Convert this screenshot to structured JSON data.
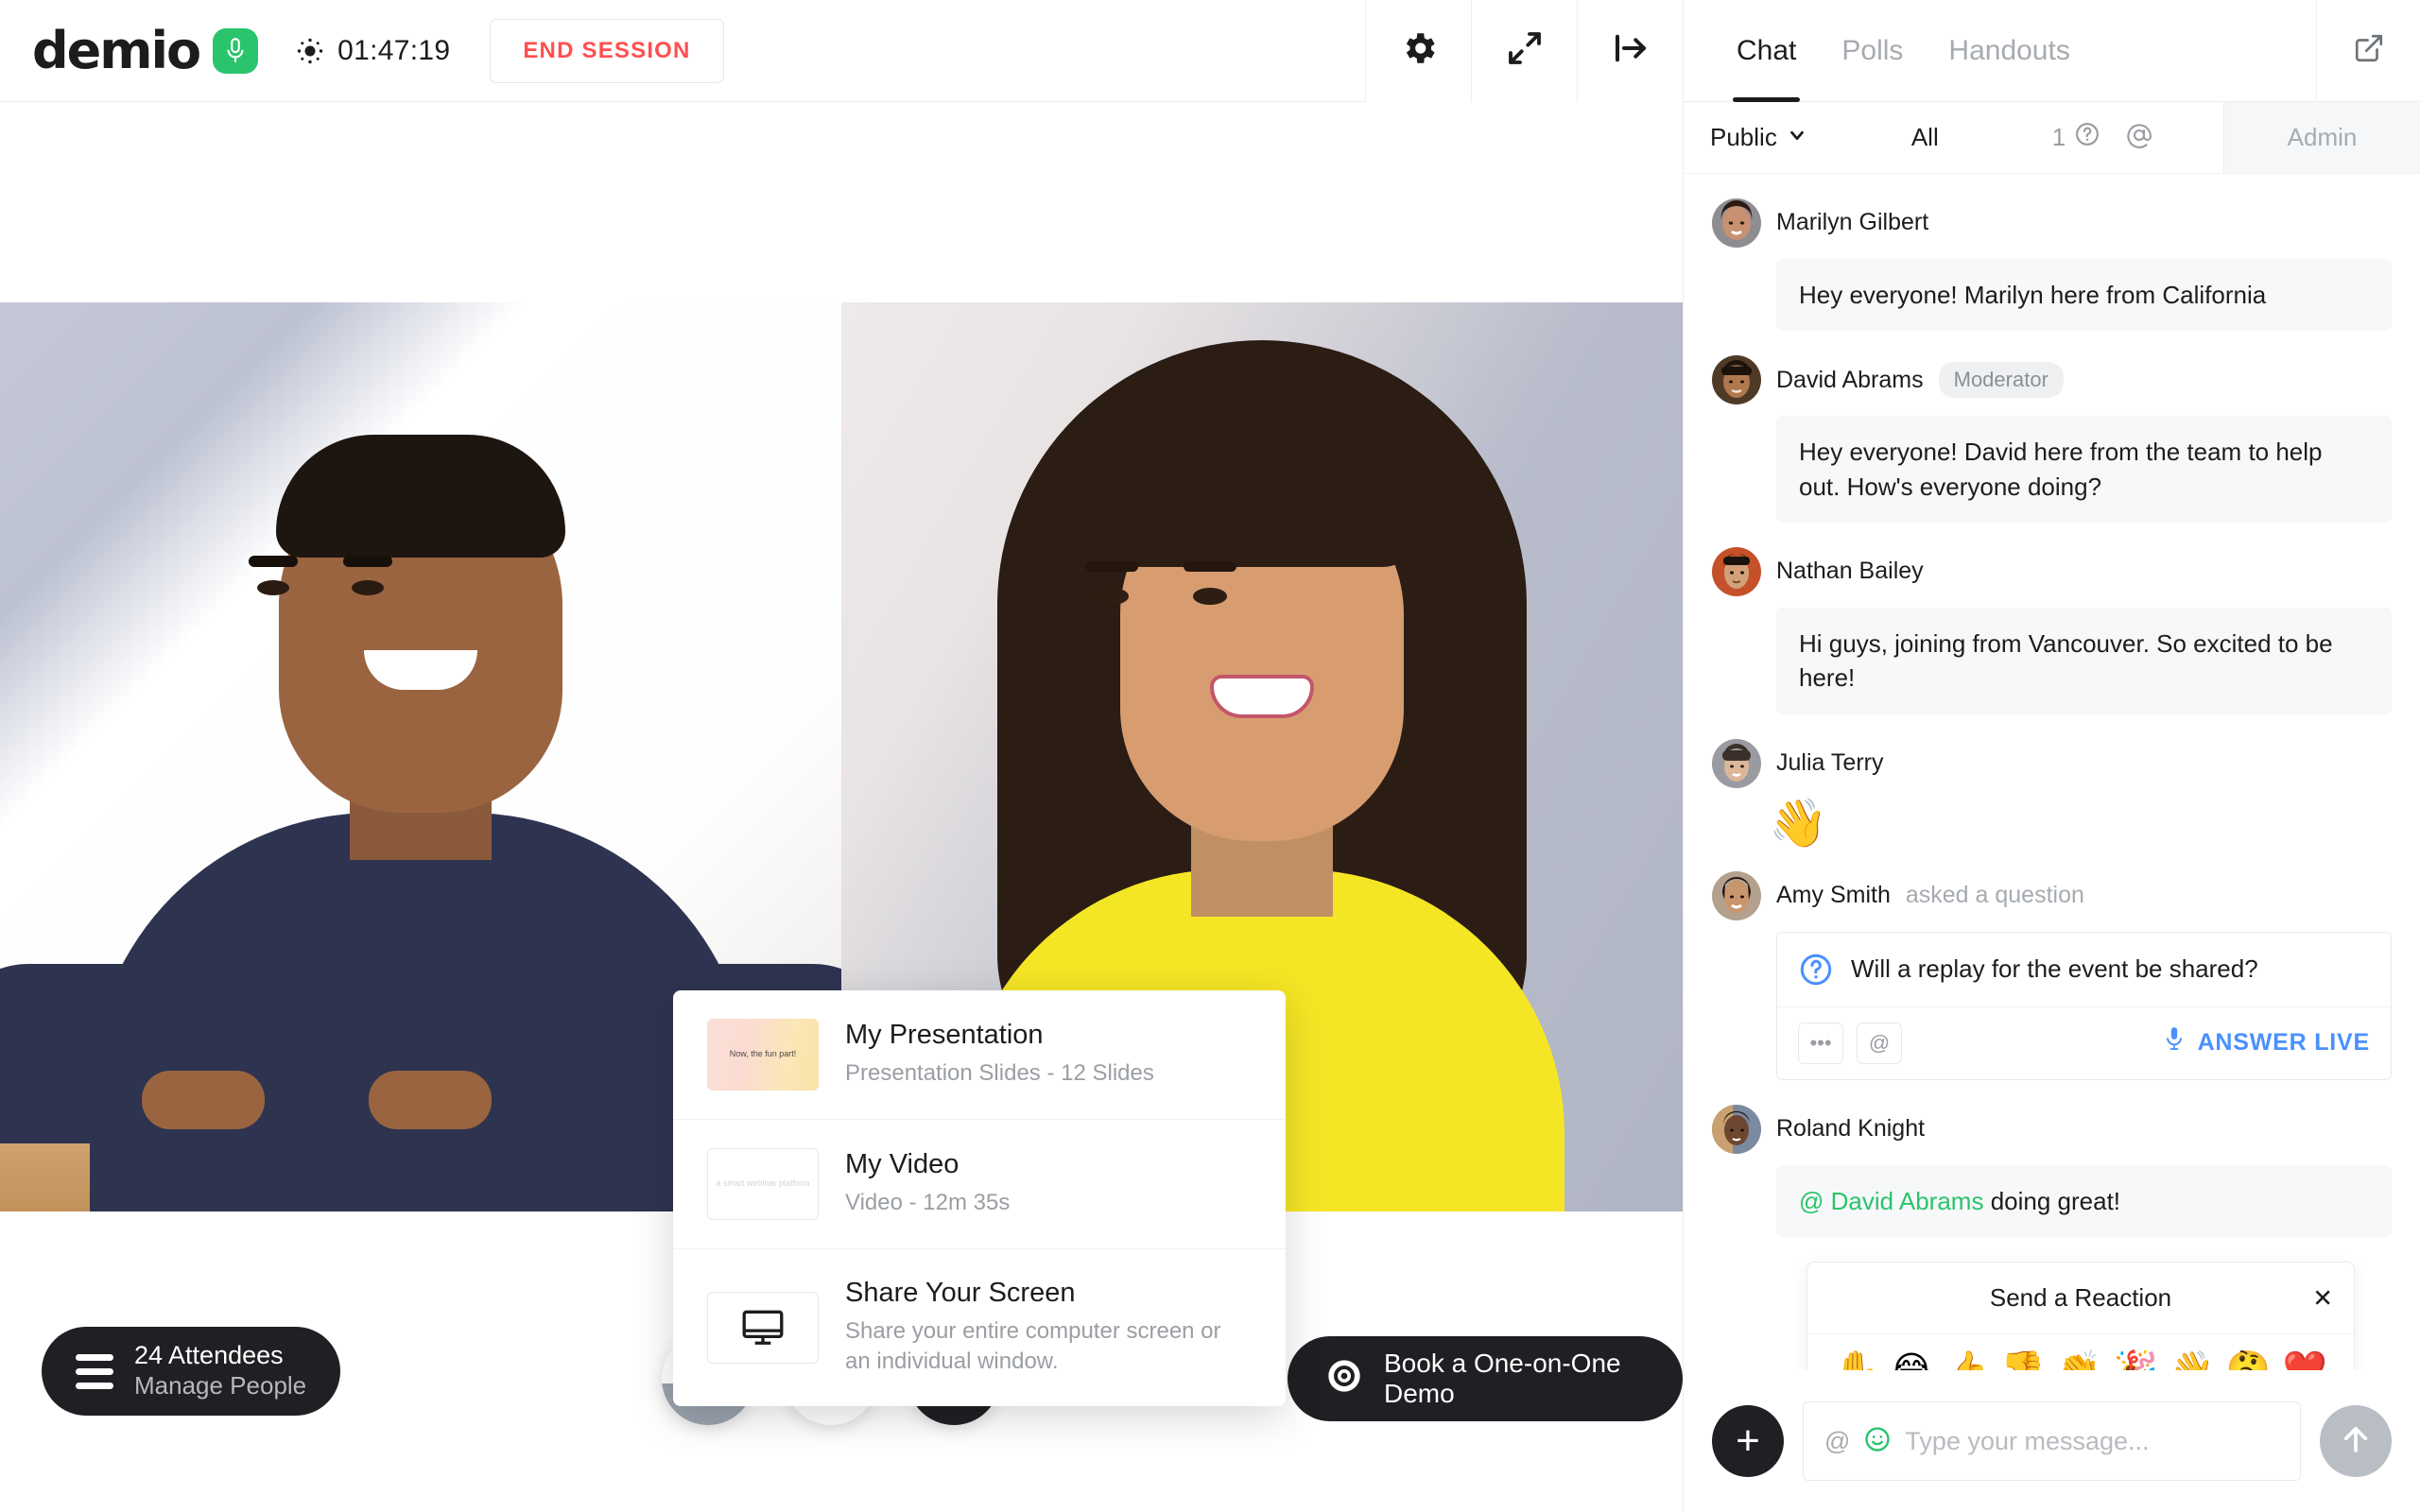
{
  "topbar": {
    "logo_text": "demio",
    "logo_icon": "microphone-badge-icon",
    "timer": "01:47:19",
    "recording_icon": "recording-dot-icon",
    "end_session_label": "END SESSION",
    "icons": [
      {
        "name": "gear-icon",
        "label": "Settings"
      },
      {
        "name": "expand-icon",
        "label": "Fullscreen"
      },
      {
        "name": "collapse-panel-icon",
        "label": "Hide panel"
      }
    ],
    "accent_red": "#ff4f4f",
    "brand_green": "#29c46b"
  },
  "share_menu": {
    "items": [
      {
        "title": "My Presentation",
        "subtitle": "Presentation Slides - 12 Slides",
        "thumb_caption": "Now, the fun part!",
        "thumb_type": "presentation"
      },
      {
        "title": "My Video",
        "subtitle": "Video - 12m 35s",
        "thumb_caption": "a smart webinar platform",
        "thumb_type": "video"
      },
      {
        "title": "Share Your Screen",
        "subtitle": "Share your entire computer screen or an individual window.",
        "thumb_caption": "",
        "thumb_type": "monitor-icon"
      }
    ]
  },
  "bottombar": {
    "attendees_count": "24 Attendees",
    "manage_people": "Manage People",
    "controls": [
      {
        "name": "microphone-icon",
        "state": "half-muted"
      },
      {
        "name": "webcam-icon",
        "state": "on"
      },
      {
        "name": "camera-off-icon",
        "state": "off"
      }
    ],
    "demo_button": "Book a One-on-One Demo",
    "demo_icon": "target-icon"
  },
  "chat": {
    "tabs": [
      {
        "label": "Chat",
        "active": true
      },
      {
        "label": "Polls",
        "active": false
      },
      {
        "label": "Handouts",
        "active": false
      }
    ],
    "popout_icon": "external-link-icon",
    "filters": {
      "visibility": "Public",
      "visibility_caret": "chevron-down-icon",
      "all": "All",
      "question_count": "1",
      "question_icon": "question-circle-icon",
      "mention_icon": "at-icon",
      "admin": "Admin"
    },
    "messages": [
      {
        "name": "Marilyn Gilbert",
        "badge": "",
        "sub": "",
        "text": "Hey everyone! Marilyn here from California",
        "type": "text",
        "avatar_skin": "#c89172",
        "avatar_hair": "#2a1a12",
        "avatar_bg": "#8d8d92"
      },
      {
        "name": "David Abrams",
        "badge": "Moderator",
        "sub": "",
        "text": "Hey everyone! David here from the team to help out. How's everyone doing?",
        "type": "text",
        "avatar_skin": "#b0784f",
        "avatar_hair": "#1d1209",
        "avatar_bg": "#4f3a28"
      },
      {
        "name": "Nathan Bailey",
        "badge": "",
        "sub": "",
        "text": "Hi guys, joining from Vancouver. So excited to be here!",
        "type": "text",
        "avatar_skin": "#d2a17a",
        "avatar_hair": "#1a130d",
        "avatar_bg": "#c4512a"
      },
      {
        "name": "Julia Terry",
        "badge": "",
        "sub": "",
        "text": "👋",
        "type": "emoji",
        "avatar_skin": "#ddb79a",
        "avatar_hair": "#3b3029",
        "avatar_bg": "#9a9ba0"
      },
      {
        "name": "Amy Smith",
        "badge": "",
        "sub": "asked a question",
        "text": "Will a replay for the event be shared?",
        "type": "question",
        "question_icon": "question-circle-icon",
        "more_icon": "ellipsis-icon",
        "mention_icon": "at-icon",
        "answer_live_label": "ANSWER LIVE",
        "answer_live_icon": "microphone-icon",
        "answer_live_color": "#4a90ff",
        "avatar_skin": "#c9956c",
        "avatar_hair": "#241611",
        "avatar_bg": "#b3a08d"
      },
      {
        "name": "Roland Knight",
        "badge": "",
        "sub": "",
        "mention": "@ David Abrams",
        "text": " doing great!",
        "type": "mention",
        "mention_color": "#29c46b",
        "avatar_skin": "#6d4630",
        "avatar_hair": "#16100b",
        "avatar_bg": "#7b8aa0"
      }
    ],
    "reaction_panel": {
      "title": "Send a Reaction",
      "close_icon": "close-icon",
      "emojis": [
        "✋",
        "😂",
        "👍",
        "👎",
        "👏",
        "🎉",
        "👋",
        "🤔",
        "❤️"
      ]
    },
    "composer": {
      "add_icon": "plus-icon",
      "mention_icon": "at-icon",
      "emoji_icon": "smiley-icon",
      "placeholder": "Type your message...",
      "value": "",
      "send_icon": "arrow-up-icon"
    }
  }
}
